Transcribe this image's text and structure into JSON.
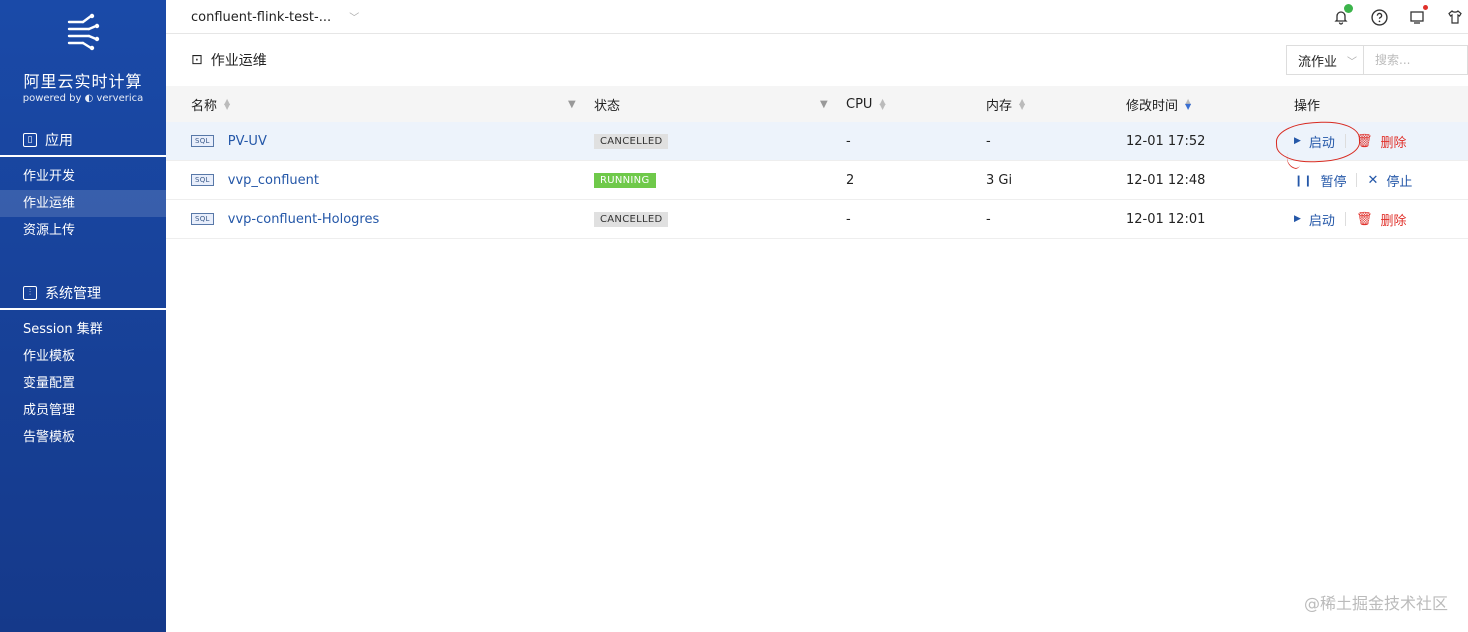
{
  "sidebar": {
    "brand_title": "阿里云实时计算",
    "brand_sub": "powered by",
    "brand_partner": "ververica",
    "sections": [
      {
        "title": "应用",
        "icon": "app-icon",
        "items": [
          {
            "label": "作业开发",
            "active": false
          },
          {
            "label": "作业运维",
            "active": true
          },
          {
            "label": "资源上传",
            "active": false
          }
        ]
      },
      {
        "title": "系统管理",
        "icon": "settings-icon",
        "items": [
          {
            "label": "Session 集群"
          },
          {
            "label": "作业模板"
          },
          {
            "label": "变量配置"
          },
          {
            "label": "成员管理"
          },
          {
            "label": "告警模板"
          }
        ]
      }
    ]
  },
  "topbar": {
    "project": "confluent-flink-test-...",
    "icons": [
      "bell-icon",
      "help-icon",
      "screen-icon",
      "shirt-icon"
    ]
  },
  "page": {
    "title": "作业运维",
    "filter_select": "流作业",
    "search_placeholder": "搜索..."
  },
  "table": {
    "headers": {
      "name": "名称",
      "status": "状态",
      "cpu": "CPU",
      "memory": "内存",
      "modified": "修改时间",
      "ops": "操作"
    },
    "rows": [
      {
        "tag": "SQL",
        "name": "PV-UV",
        "status": "CANCELLED",
        "cpu": "-",
        "memory": "-",
        "modified": "12-01 17:52",
        "op1": "启动",
        "op2": "删除"
      },
      {
        "tag": "SQL",
        "name": "vvp_confluent",
        "status": "RUNNING",
        "cpu": "2",
        "memory": "3 Gi",
        "modified": "12-01 12:48",
        "op1": "暂停",
        "op2": "停止"
      },
      {
        "tag": "SQL",
        "name": "vvp-confluent-Hologres",
        "status": "CANCELLED",
        "cpu": "-",
        "memory": "-",
        "modified": "12-01 12:01",
        "op1": "启动",
        "op2": "删除"
      }
    ]
  },
  "watermark": "@稀土掘金技术社区"
}
